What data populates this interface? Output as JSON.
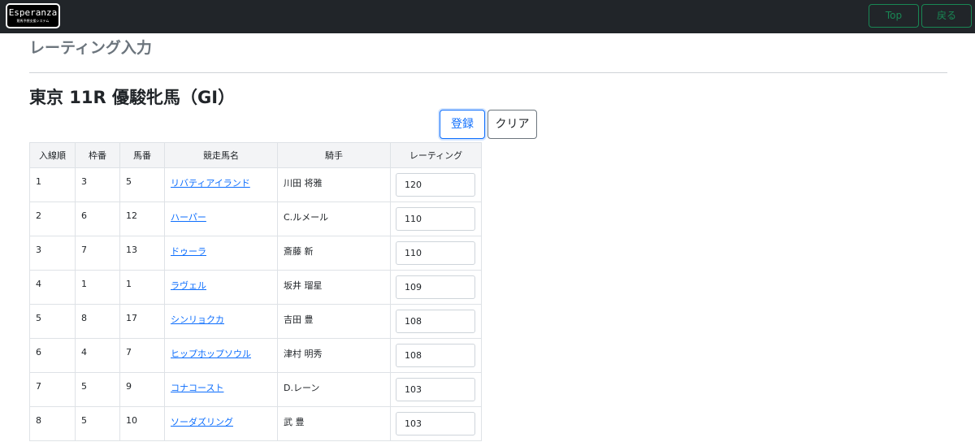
{
  "navbar": {
    "logo_main": "Esperanza",
    "logo_sub": "競馬予想支援システム",
    "top_label": "Top",
    "back_label": "戻る"
  },
  "page": {
    "title": "レーティング入力",
    "race_title": "東京 11R 優駿牝馬（GI）"
  },
  "actions": {
    "register_label": "登録",
    "clear_label": "クリア"
  },
  "table": {
    "headers": [
      "入線順",
      "枠番",
      "馬番",
      "競走馬名",
      "騎手",
      "レーティング"
    ],
    "rows": [
      {
        "order": "1",
        "frame": "3",
        "number": "5",
        "horse": "リバティアイランド",
        "jockey": "川田 将雅",
        "rating": "120"
      },
      {
        "order": "2",
        "frame": "6",
        "number": "12",
        "horse": "ハーパー",
        "jockey": "C.ルメール",
        "rating": "110"
      },
      {
        "order": "3",
        "frame": "7",
        "number": "13",
        "horse": "ドゥーラ",
        "jockey": "斎藤 新",
        "rating": "110"
      },
      {
        "order": "4",
        "frame": "1",
        "number": "1",
        "horse": "ラヴェル",
        "jockey": "坂井 瑠星",
        "rating": "109"
      },
      {
        "order": "5",
        "frame": "8",
        "number": "17",
        "horse": "シンリョクカ",
        "jockey": "吉田 豊",
        "rating": "108"
      },
      {
        "order": "6",
        "frame": "4",
        "number": "7",
        "horse": "ヒップホップソウル",
        "jockey": "津村 明秀",
        "rating": "108"
      },
      {
        "order": "7",
        "frame": "5",
        "number": "9",
        "horse": "コナコースト",
        "jockey": "D.レーン",
        "rating": "103"
      },
      {
        "order": "8",
        "frame": "5",
        "number": "10",
        "horse": "ソーダズリング",
        "jockey": "武 豊",
        "rating": "103"
      }
    ]
  },
  "colors": {
    "navbar_bg": "#212529",
    "nav_button": "#198754",
    "primary": "#0d6efd",
    "muted_title": "#6c757d"
  }
}
